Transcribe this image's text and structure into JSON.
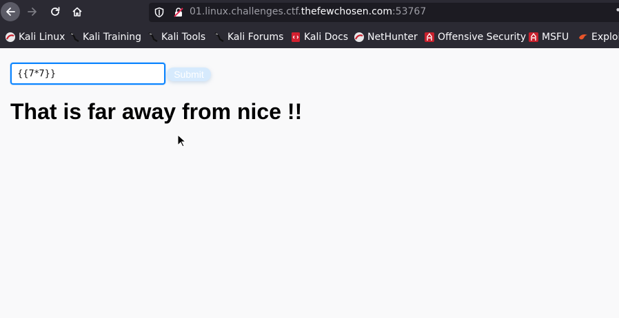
{
  "browser": {
    "url_prefix": "01.linux.challenges.ctf.",
    "url_domain": "thefewchosen.com",
    "url_port": ":53767",
    "more_menu": "•",
    "bookmarks": [
      {
        "label": "Kali Linux",
        "icon": "kali-icon"
      },
      {
        "label": "Kali Training",
        "icon": "kali-dragon-icon"
      },
      {
        "label": "Kali Tools",
        "icon": "kali-dragon-icon"
      },
      {
        "label": "Kali Forums",
        "icon": "kali-dragon-icon"
      },
      {
        "label": "Kali Docs",
        "icon": "docs-icon"
      },
      {
        "label": "NetHunter",
        "icon": "nethunter-icon"
      },
      {
        "label": "Offensive Security",
        "icon": "offsec-icon"
      },
      {
        "label": "MSFU",
        "icon": "offsec-icon"
      },
      {
        "label": "Exploit",
        "icon": "exploit-db-icon"
      }
    ]
  },
  "form": {
    "input_value": "{{7*7}}",
    "submit_label": "Submit"
  },
  "message": "That is far away from nice !!",
  "colors": {
    "chrome_bg": "#2b2a33",
    "urlbar_bg": "#1c1b22",
    "focus_ring": "#0a84ff",
    "page_bg": "#f9f9fa"
  }
}
